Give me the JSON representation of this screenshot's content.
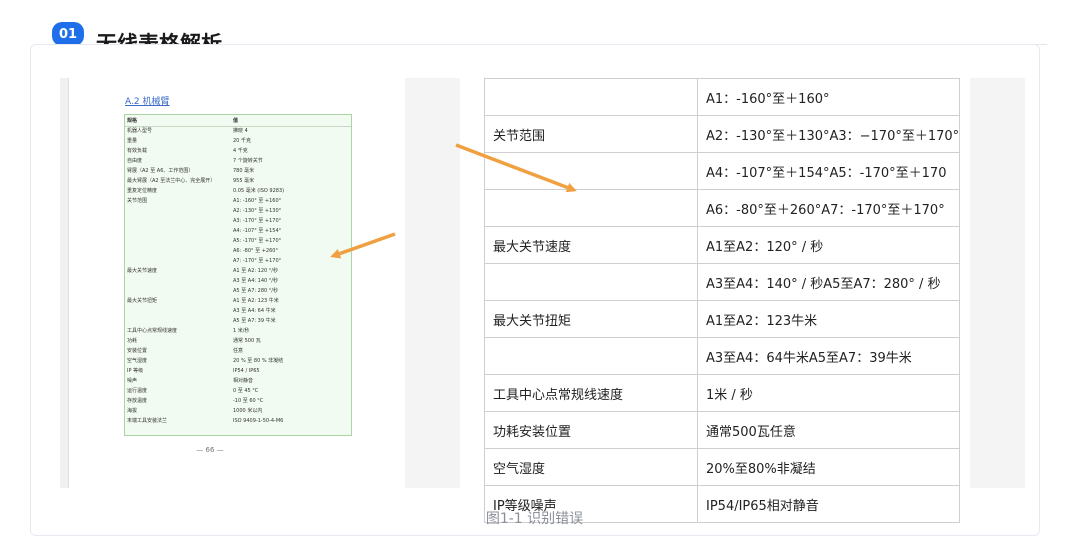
{
  "header": {
    "badge": "01",
    "title": "无线表格解析"
  },
  "left_page": {
    "section_title": "A.2 机械臂",
    "rows": [
      {
        "k": "规格",
        "v": "值"
      },
      {
        "k": "机器人型号",
        "v": "拂晓 4"
      },
      {
        "k": "重量",
        "v": "20 千克"
      },
      {
        "k": "有效负载",
        "v": "4 千克"
      },
      {
        "k": "自由度",
        "v": "7 个旋转关节"
      },
      {
        "k": "臂展（A2 至 A6、工作范围）",
        "v": "780 毫米"
      },
      {
        "k": "最大臂展（A2 至法兰中心、完全展开）",
        "v": "955 毫米"
      },
      {
        "k": "重复定位精度",
        "v": "0.05 毫米 (ISO 9283)"
      },
      {
        "k": "关节范围",
        "v": "A1: -160° 至 +160°"
      },
      {
        "k": "",
        "v": "A2: -130° 至 +130°"
      },
      {
        "k": "",
        "v": "A3: -170° 至 +170°"
      },
      {
        "k": "",
        "v": "A4: -107° 至 +154°"
      },
      {
        "k": "",
        "v": "A5: -170° 至 +170°"
      },
      {
        "k": "",
        "v": "A6: -80° 至 +260°"
      },
      {
        "k": "",
        "v": "A7: -170° 至 +170°"
      },
      {
        "k": "最大关节速度",
        "v": "A1 至 A2: 120 °/秒"
      },
      {
        "k": "",
        "v": "A3 至 A4: 140 °/秒"
      },
      {
        "k": "",
        "v": "A5 至 A7: 280 °/秒"
      },
      {
        "k": "最大关节扭矩",
        "v": "A1 至 A2: 123 牛米"
      },
      {
        "k": "",
        "v": "A3 至 A4: 64 牛米"
      },
      {
        "k": "",
        "v": "A5 至 A7: 39 牛米"
      },
      {
        "k": "工具中心点常规线速度",
        "v": "1 米/秒"
      },
      {
        "k": "功耗",
        "v": "通常 500 瓦"
      },
      {
        "k": "安装位置",
        "v": "任意"
      },
      {
        "k": "空气湿度",
        "v": "20 % 至 80 % 非凝结"
      },
      {
        "k": "IP 等级",
        "v": "IP54 / IP65"
      },
      {
        "k": "噪声",
        "v": "相对静音"
      },
      {
        "k": "运行温度",
        "v": "0 至 45 °C"
      },
      {
        "k": "存放温度",
        "v": "-10 至 60 °C"
      },
      {
        "k": "海拔",
        "v": "1000 米以内"
      },
      {
        "k": "末端工具安装法兰",
        "v": "ISO 9409-1-50-4-M6"
      }
    ],
    "page_number": "— 66 —"
  },
  "right_table": [
    {
      "k": "",
      "v": "A1：-160°至＋160°"
    },
    {
      "k": "关节范围",
      "v": "A2：-130°至＋130°A3：−170°至＋170°"
    },
    {
      "k": "",
      "v": "A4：-107°至＋154°A5：-170°至＋170"
    },
    {
      "k": "",
      "v": "A6：-80°至＋260°A7：-170°至＋170°"
    },
    {
      "k": "最大关节速度",
      "v": "A1至A2：120° / 秒"
    },
    {
      "k": "",
      "v": "A3至A4：140° / 秒A5至A7：280° / 秒"
    },
    {
      "k": "最大关节扭矩",
      "v": "A1至A2：123牛米"
    },
    {
      "k": "",
      "v": "A3至A4：64牛米A5至A7：39牛米"
    },
    {
      "k": "工具中心点常规线速度",
      "v": "1米 / 秒"
    },
    {
      "k": "功耗安装位置",
      "v": "通常500瓦任意"
    },
    {
      "k": "空气湿度",
      "v": "20%至80%非凝结"
    },
    {
      "k": "IP等级噪声",
      "v": "IP54/IP65相对静音"
    }
  ],
  "caption": "图1-1 识别错误",
  "colors": {
    "accent": "#1f6feb",
    "arrow": "#f0a040",
    "green_border": "#a9d6a3"
  }
}
